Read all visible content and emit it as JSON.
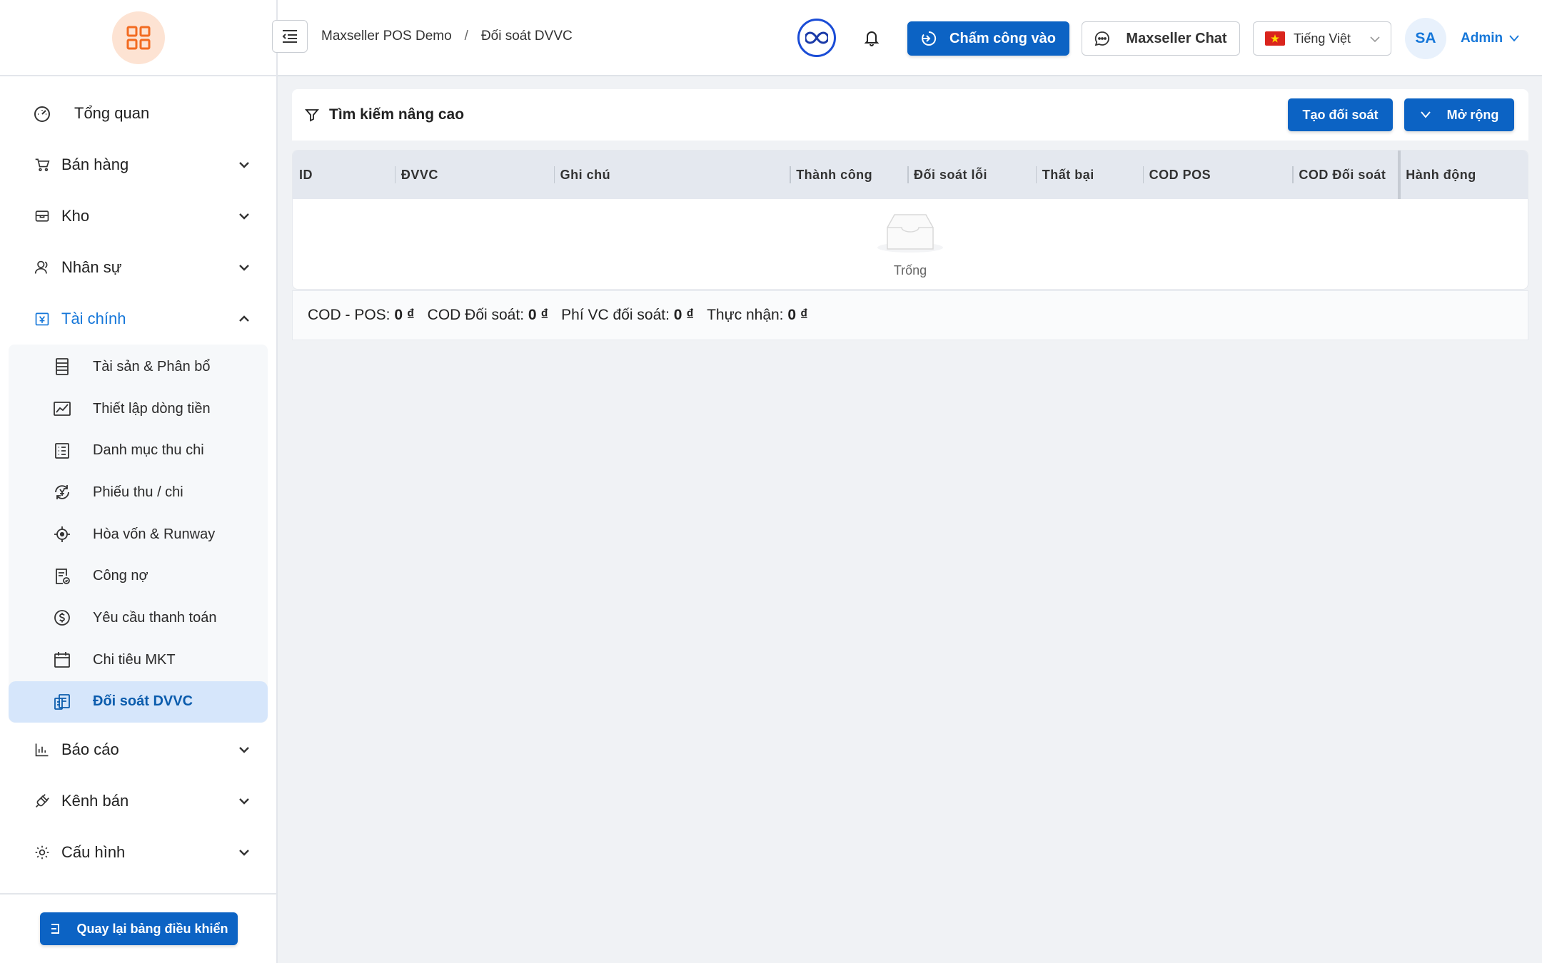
{
  "sidebar": {
    "menu": [
      {
        "label": "Tổng quan",
        "icon": "dashboard-icon"
      },
      {
        "label": "Bán hàng",
        "icon": "cart-icon"
      },
      {
        "label": "Kho",
        "icon": "warehouse-icon"
      },
      {
        "label": "Nhân sự",
        "icon": "users-icon"
      },
      {
        "label": "Tài chính",
        "icon": "finance-icon"
      }
    ],
    "finance_sub": [
      {
        "label": "Tài sản & Phân bổ"
      },
      {
        "label": "Thiết lập dòng tiền"
      },
      {
        "label": "Danh mục thu chi"
      },
      {
        "label": "Phiếu thu / chi"
      },
      {
        "label": "Hòa vốn & Runway"
      },
      {
        "label": "Công nợ"
      },
      {
        "label": "Yêu cầu thanh toán"
      },
      {
        "label": "Chi tiêu MKT"
      },
      {
        "label": "Đối soát DVVC"
      }
    ],
    "menu_bottom": [
      {
        "label": "Báo cáo"
      },
      {
        "label": "Kênh bán"
      },
      {
        "label": "Cấu hình"
      }
    ],
    "back_label": "Quay lại bảng điều khiển"
  },
  "header": {
    "breadcrumb_root": "Maxseller POS Demo",
    "breadcrumb_sep": "/",
    "breadcrumb_current": "Đối soát DVVC",
    "punch_label": "Chấm công vào",
    "chat_label": "Maxseller Chat",
    "language": "Tiếng Việt",
    "avatar_initials": "SA",
    "user_name": "Admin"
  },
  "search": {
    "title": "Tìm kiếm nâng cao",
    "create_label": "Tạo đối soát",
    "expand_label": "Mở rộng"
  },
  "table": {
    "columns": [
      "ID",
      "ĐVVC",
      "Ghi chú",
      "Thành công",
      "Đối soát lỗi",
      "Thất bại",
      "COD POS",
      "COD Đối soát",
      "Hành động"
    ],
    "empty_text": "Trống"
  },
  "summary": {
    "cod_pos_label": "COD - POS:",
    "cod_pos_value": "0 ₫",
    "cod_reconcile_label": "COD Đối soát:",
    "cod_reconcile_value": "0 ₫",
    "ship_fee_label": "Phí VC đối soát:",
    "ship_fee_value": "0 ₫",
    "received_label": "Thực nhận:",
    "received_value": "0 ₫"
  },
  "colors": {
    "primary": "#0c63c4",
    "link": "#1677d9",
    "active_bg": "#d6e6fb",
    "logo_bg": "#fde3d3",
    "logo_fg": "#f26b21"
  }
}
